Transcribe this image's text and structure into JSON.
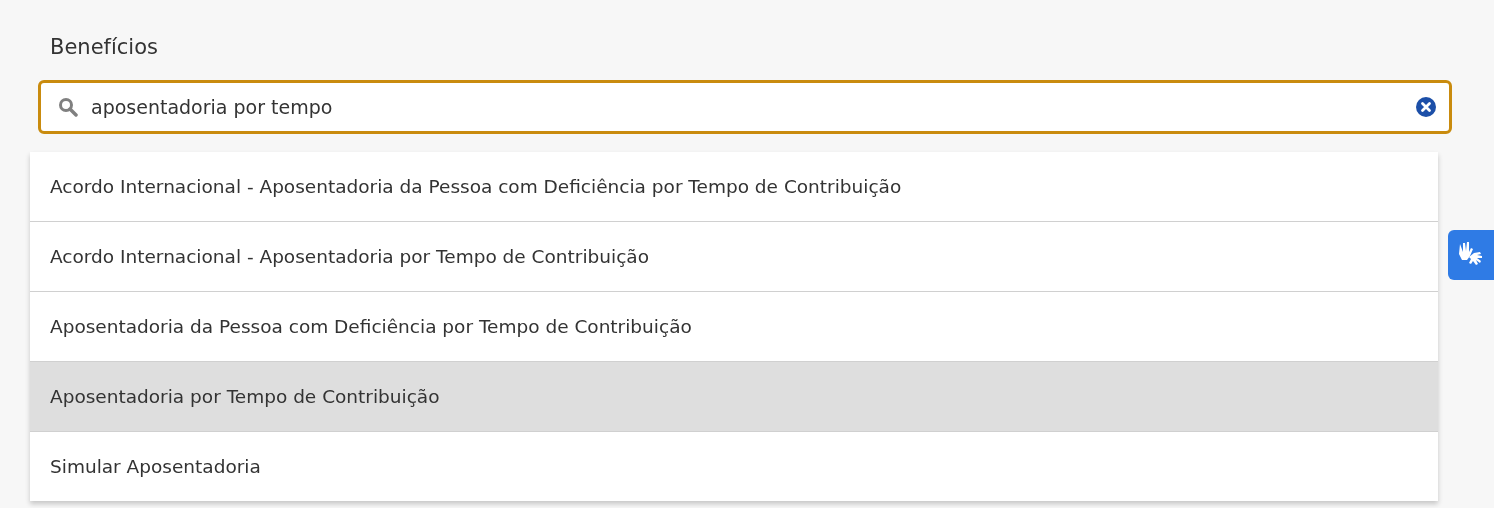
{
  "section_title": "Benefícios",
  "search": {
    "value": "aposentadoria por tempo"
  },
  "suggestions": [
    {
      "label": "Acordo Internacional - Aposentadoria da Pessoa com Deficiência por Tempo de Contribuição",
      "selected": false
    },
    {
      "label": "Acordo Internacional - Aposentadoria por Tempo de Contribuição",
      "selected": false
    },
    {
      "label": "Aposentadoria da Pessoa com Deficiência por Tempo de Contribuição",
      "selected": false
    },
    {
      "label": "Aposentadoria por Tempo de Contribuição",
      "selected": true
    },
    {
      "label": "Simular Aposentadoria",
      "selected": false
    }
  ]
}
